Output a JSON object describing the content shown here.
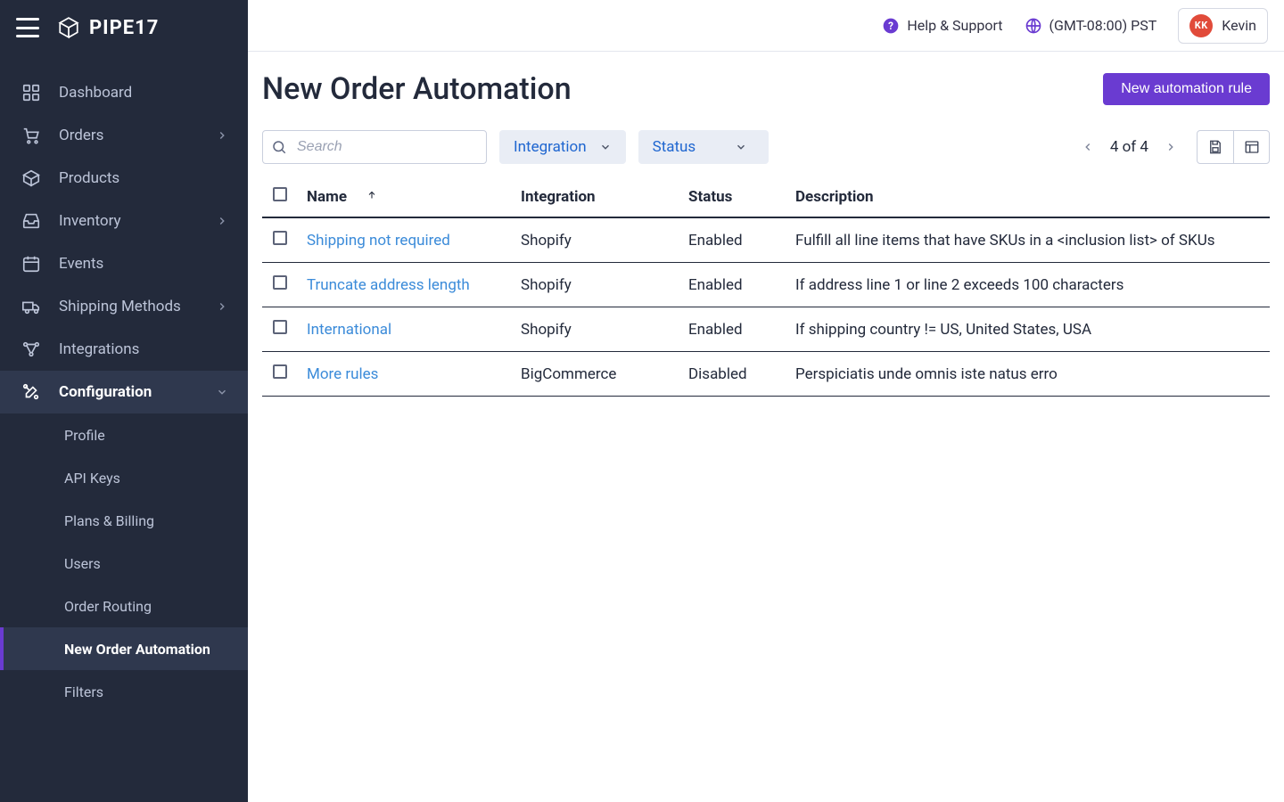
{
  "brand": "PIPE17",
  "sidebar": {
    "items": [
      {
        "label": "Dashboard",
        "icon": "grid",
        "chev": false
      },
      {
        "label": "Orders",
        "icon": "cart",
        "chev": true
      },
      {
        "label": "Products",
        "icon": "box",
        "chev": false
      },
      {
        "label": "Inventory",
        "icon": "inbox",
        "chev": true
      },
      {
        "label": "Events",
        "icon": "calendar",
        "chev": false
      },
      {
        "label": "Shipping Methods",
        "icon": "truck",
        "chev": true
      },
      {
        "label": "Integrations",
        "icon": "nodes",
        "chev": false
      },
      {
        "label": "Configuration",
        "icon": "tools",
        "chev": true,
        "active": true
      }
    ],
    "sub": [
      {
        "label": "Profile"
      },
      {
        "label": "API Keys"
      },
      {
        "label": "Plans & Billing"
      },
      {
        "label": "Users"
      },
      {
        "label": "Order Routing"
      },
      {
        "label": "New Order Automation",
        "active": true
      },
      {
        "label": "Filters"
      }
    ]
  },
  "topbar": {
    "help_label": "Help & Support",
    "tz_label": "(GMT-08:00) PST",
    "user_initials": "KK",
    "user_name": "Kevin"
  },
  "page": {
    "title": "New Order Automation",
    "new_button": "New automation rule"
  },
  "toolbar": {
    "search_placeholder": "Search",
    "filter_integration": "Integration",
    "filter_status": "Status",
    "pager_text": "4 of 4"
  },
  "table": {
    "headers": {
      "name": "Name",
      "integration": "Integration",
      "status": "Status",
      "description": "Description"
    },
    "rows": [
      {
        "name": "Shipping not required",
        "integration": "Shopify",
        "status": "Enabled",
        "description": "Fulfill all line items that have SKUs in a <inclusion list> of SKUs"
      },
      {
        "name": "Truncate address length",
        "integration": "Shopify",
        "status": "Enabled",
        "description": "If address line 1 or line 2 exceeds 100 characters"
      },
      {
        "name": "International",
        "integration": "Shopify",
        "status": "Enabled",
        "description": "If shipping country != US, United States, USA"
      },
      {
        "name": "More rules",
        "integration": "BigCommerce",
        "status": "Disabled",
        "description": "Perspiciatis unde omnis iste natus erro"
      }
    ]
  }
}
